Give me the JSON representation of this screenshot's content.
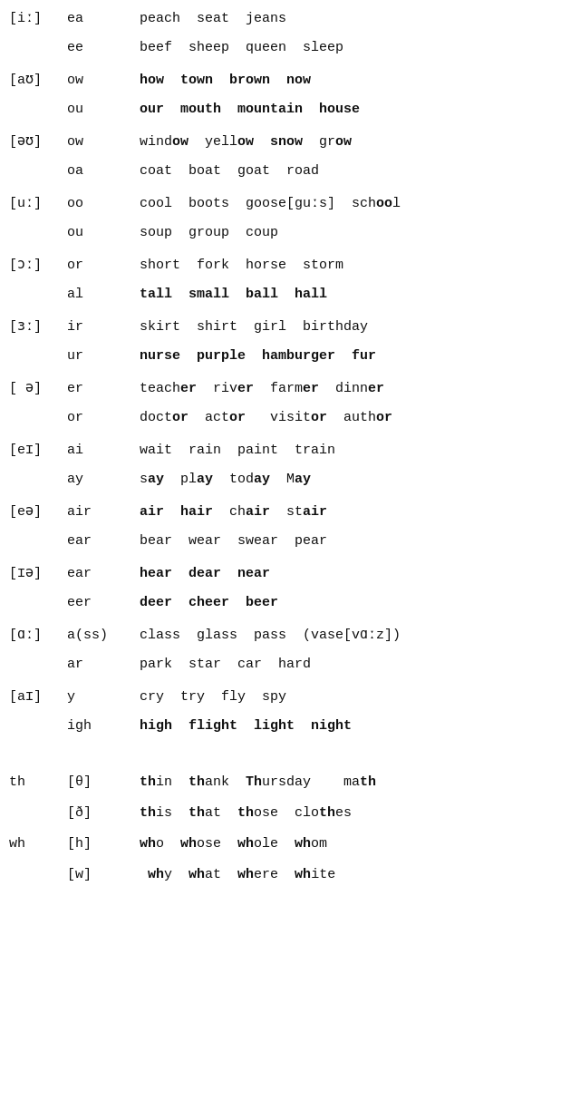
{
  "rows": [
    {
      "phoneme": "[iː]",
      "spelling": "ea",
      "examples": "peach  seat  jeans",
      "boldWords": []
    },
    {
      "phoneme": "",
      "spelling": "ee",
      "examples": "beef  sheep  queen  sleep",
      "boldWords": []
    },
    {
      "phoneme": "[aʊ]",
      "spelling": "ow",
      "examples": "how  town  brown  now",
      "boldWords": [
        "how",
        "town",
        "brown",
        "now"
      ]
    },
    {
      "phoneme": "",
      "spelling": "ou",
      "examples": "our  mouth  mountain  house",
      "boldWords": [
        "our",
        "mouth",
        "mountain",
        "house"
      ]
    },
    {
      "phoneme": "[əʊ]",
      "spelling": "ow",
      "examples": "window  yellow  snow  grow",
      "boldWords": [
        "ow",
        "yellow",
        "snow",
        "grow"
      ]
    },
    {
      "phoneme": "",
      "spelling": "oa",
      "examples": "coat  boat  goat  road",
      "boldWords": []
    },
    {
      "phoneme": "[uː]",
      "spelling": "oo",
      "examples": "cool  boots  goose[guːs]  school",
      "boldWords": []
    },
    {
      "phoneme": "",
      "spelling": "ou",
      "examples": "soup  group  coup",
      "boldWords": []
    },
    {
      "phoneme": "[ɔː]",
      "spelling": "or",
      "examples": "short  fork  horse  storm",
      "boldWords": []
    },
    {
      "phoneme": "",
      "spelling": "al",
      "examples": "tall  small  ball  hall",
      "boldWords": [
        "tall",
        "small",
        "ball",
        "hall"
      ]
    },
    {
      "phoneme": "[ɜː]",
      "spelling": "ir",
      "examples": "skirt  shirt  girl  birthday",
      "boldWords": []
    },
    {
      "phoneme": "",
      "spelling": "ur",
      "examples": "nurse  purple  hamburger  fur",
      "boldWords": [
        "nurse",
        "purple",
        "hamburger",
        "fur"
      ]
    },
    {
      "phoneme": "[ə]",
      "spelling": "er",
      "examples": "teacher  river  farmer  dinner",
      "boldWords": [
        "er",
        "er",
        "er",
        "er"
      ]
    },
    {
      "phoneme": "",
      "spelling": "or",
      "examples": "doctor  actor  visitor  author",
      "boldWords": [
        "or",
        "or",
        "or",
        "or"
      ]
    },
    {
      "phoneme": "[eɪ]",
      "spelling": "ai",
      "examples": "wait  rain  paint  train",
      "boldWords": []
    },
    {
      "phoneme": "",
      "spelling": "ay",
      "examples": "say  play  today  May",
      "boldWords": [
        "ay",
        "ay",
        "ay"
      ]
    },
    {
      "phoneme": "[eə]",
      "spelling": "air",
      "examples": "air  hair  chair  stair",
      "boldWords": [
        "air",
        "air",
        "air",
        "air"
      ]
    },
    {
      "phoneme": "",
      "spelling": "ear",
      "examples": "bear  wear  swear  pear",
      "boldWords": []
    },
    {
      "phoneme": "[ɪə]",
      "spelling": "ear",
      "examples": "hear  dear  near",
      "boldWords": [
        "hear",
        "dear",
        "near"
      ]
    },
    {
      "phoneme": "",
      "spelling": "eer",
      "examples": "deer  cheer  beer",
      "boldWords": [
        "deer",
        "cheer",
        "beer"
      ]
    },
    {
      "phoneme": "[ɑː]",
      "spelling": "a(ss)",
      "examples": "class  glass  pass  (vase[vɑːz])",
      "boldWords": []
    },
    {
      "phoneme": "",
      "spelling": "ar",
      "examples": "park  star  car  hard",
      "boldWords": []
    },
    {
      "phoneme": "[aɪ]",
      "spelling": "y",
      "examples": "cry  try  fly  spy",
      "boldWords": []
    },
    {
      "phoneme": "",
      "spelling": "igh",
      "examples": "high  flight  light  night",
      "boldWords": [
        "high",
        "flight",
        "light",
        "night"
      ]
    },
    {
      "phoneme": "DIVIDER",
      "spelling": "",
      "examples": "",
      "boldWords": []
    },
    {
      "phoneme": "th",
      "spelling": "[θ]",
      "examples": "thin  thank  Thursday   math",
      "boldWords": [
        "th",
        "th",
        "th"
      ]
    },
    {
      "phoneme": "",
      "spelling": "[ð]",
      "examples": "this  that  those  clothes",
      "boldWords": [
        "th",
        "th",
        "th",
        "th"
      ]
    },
    {
      "phoneme": "wh",
      "spelling": "[h]",
      "examples": "who  whose  whole  whom",
      "boldWords": [
        "wh",
        "wh",
        "wh",
        "wh"
      ]
    },
    {
      "phoneme": "",
      "spelling": "[w]",
      "examples": " why  what  where  white",
      "boldWords": [
        "wh",
        "wh",
        "wh",
        "wh"
      ]
    }
  ],
  "specialRows": {
    "row0": {
      "phoneme": "[iː]",
      "spelling": "ea",
      "ex_plain": "peach  seat  jeans"
    },
    "row1": {
      "phoneme": "",
      "spelling": "ee",
      "ex_plain": "beef  sheep  queen  sleep"
    }
  }
}
